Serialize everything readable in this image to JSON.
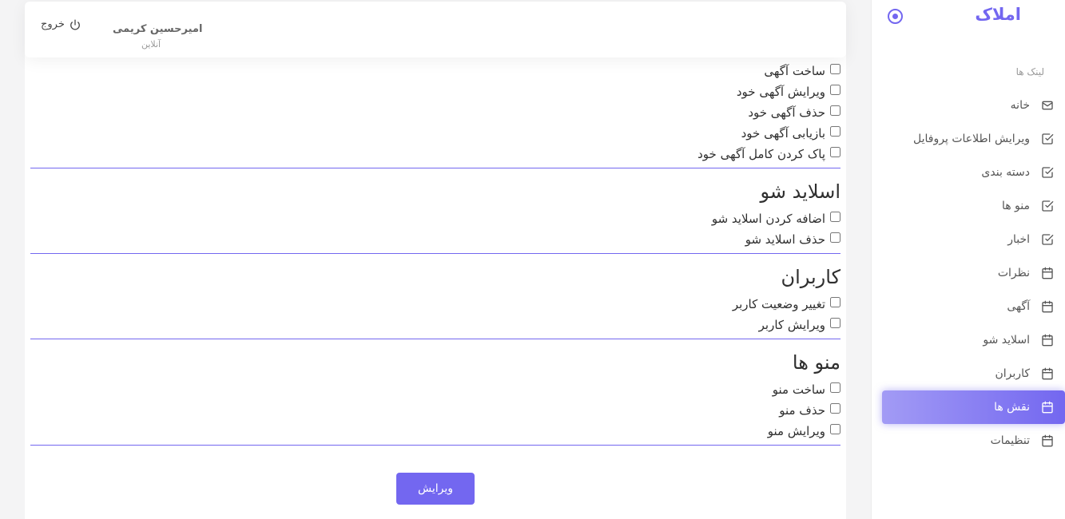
{
  "sidebar": {
    "brand": "املاک",
    "section_header": "لینک ها",
    "items": [
      {
        "label": "خانه",
        "icon": "mail-icon"
      },
      {
        "label": "ویرایش اطلاعات پروفایل",
        "icon": "check-square-icon"
      },
      {
        "label": "دسته بندی",
        "icon": "check-square-icon"
      },
      {
        "label": "منو ها",
        "icon": "check-square-icon"
      },
      {
        "label": "اخبار",
        "icon": "check-square-icon"
      },
      {
        "label": "نظرات",
        "icon": "calendar-icon"
      },
      {
        "label": "آگهی",
        "icon": "calendar-icon"
      },
      {
        "label": "اسلاید شو",
        "icon": "calendar-icon"
      },
      {
        "label": "کاربران",
        "icon": "calendar-icon"
      },
      {
        "label": "نقش ها",
        "icon": "calendar-icon",
        "active": true
      },
      {
        "label": "تنظیمات",
        "icon": "calendar-icon"
      }
    ]
  },
  "header": {
    "user_name": "امیرحسین کریمی",
    "user_status": "آنلاین",
    "logout_label": "خروج"
  },
  "permissions": {
    "ads": [
      "ساخت آگهی",
      "ویرایش آگهی خود",
      "حذف آگهی خود",
      "بازیابی آگهی خود",
      "پاک کردن کامل آگهی خود"
    ],
    "slideshow": {
      "title": "اسلاید شو",
      "items": [
        "اضافه کردن اسلاید شو",
        "حذف اسلاید شو"
      ]
    },
    "users": {
      "title": "کاربران",
      "items": [
        "تغییر وضعیت کاربر",
        "ویرایش کاربر"
      ]
    },
    "menus": {
      "title": "منو ها",
      "items": [
        "ساخت منو",
        "حذف منو",
        "ویرایش منو"
      ]
    }
  },
  "submit_label": "ویرایش",
  "colors": {
    "accent": "#7367f0"
  }
}
